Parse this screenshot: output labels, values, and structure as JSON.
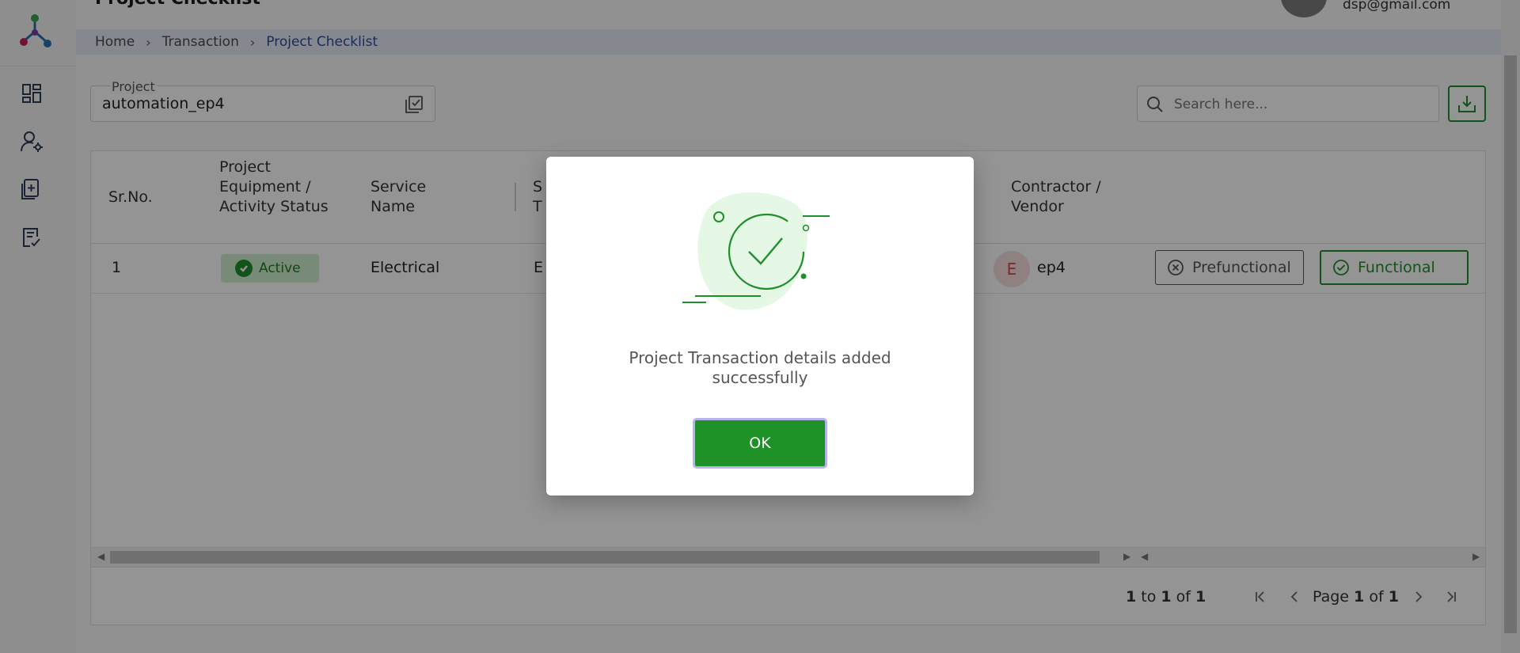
{
  "header": {
    "title": "Project Checklist",
    "user_email": "dsp@gmail.com"
  },
  "breadcrumb": [
    "Home",
    "Transaction",
    "Project Checklist"
  ],
  "project_field": {
    "label": "Project",
    "value": "automation_ep4"
  },
  "search": {
    "placeholder": "Search here..."
  },
  "table": {
    "columns": [
      "Sr.No.",
      "Project Equipment / Activity Status",
      "Service Name",
      "S T",
      "Contractor / Vendor"
    ],
    "rows": [
      {
        "sr_no": "1",
        "status": "Active",
        "service_name": "Electrical",
        "partial_col": "E",
        "vendor_initial": "E",
        "vendor": "ep4",
        "action_prefunctional": "Prefunctional",
        "action_functional": "Functional"
      }
    ]
  },
  "pager": {
    "from": "1",
    "to": "1",
    "total": "1",
    "page": "1",
    "pages": "1"
  },
  "modal": {
    "message": "Project Transaction details added successfully",
    "ok_label": "OK"
  },
  "colors": {
    "accent_green": "#1e8f2a",
    "breadcrumb_active": "#2e4d9a"
  }
}
